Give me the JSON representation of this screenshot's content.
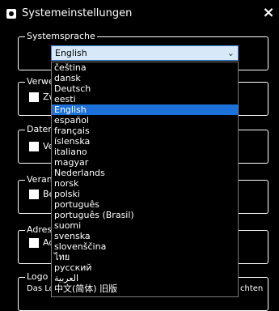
{
  "window": {
    "title": "Systemeinstellungen",
    "close_label": "×"
  },
  "groups": {
    "system_language": {
      "legend": "Systemsprache"
    },
    "g2": {
      "legend": "Verwen",
      "checkbox_label": "Zw"
    },
    "g3": {
      "legend": "Datenv",
      "checkbox_label": "Ve"
    },
    "g4": {
      "legend": "Veranst",
      "checkbox_label": "Be"
    },
    "g5": {
      "legend": "Adress",
      "checkbox_label": "Ad"
    },
    "g6": {
      "legend": "Logo d",
      "text_left": "Das Lo",
      "text_right": "chten"
    }
  },
  "language_select": {
    "value": "English",
    "options": [
      "čeština",
      "dansk",
      "Deutsch",
      "eesti",
      "English",
      "español",
      "français",
      "íslenska",
      "italiano",
      "magyar",
      "Nederlands",
      "norsk",
      "polski",
      "português",
      "português (Brasil)",
      "suomi",
      "svenska",
      "slovenščina",
      "ไทย",
      "русский",
      "العربية",
      "中文(简体) 旧版"
    ],
    "selected_index": 4
  }
}
